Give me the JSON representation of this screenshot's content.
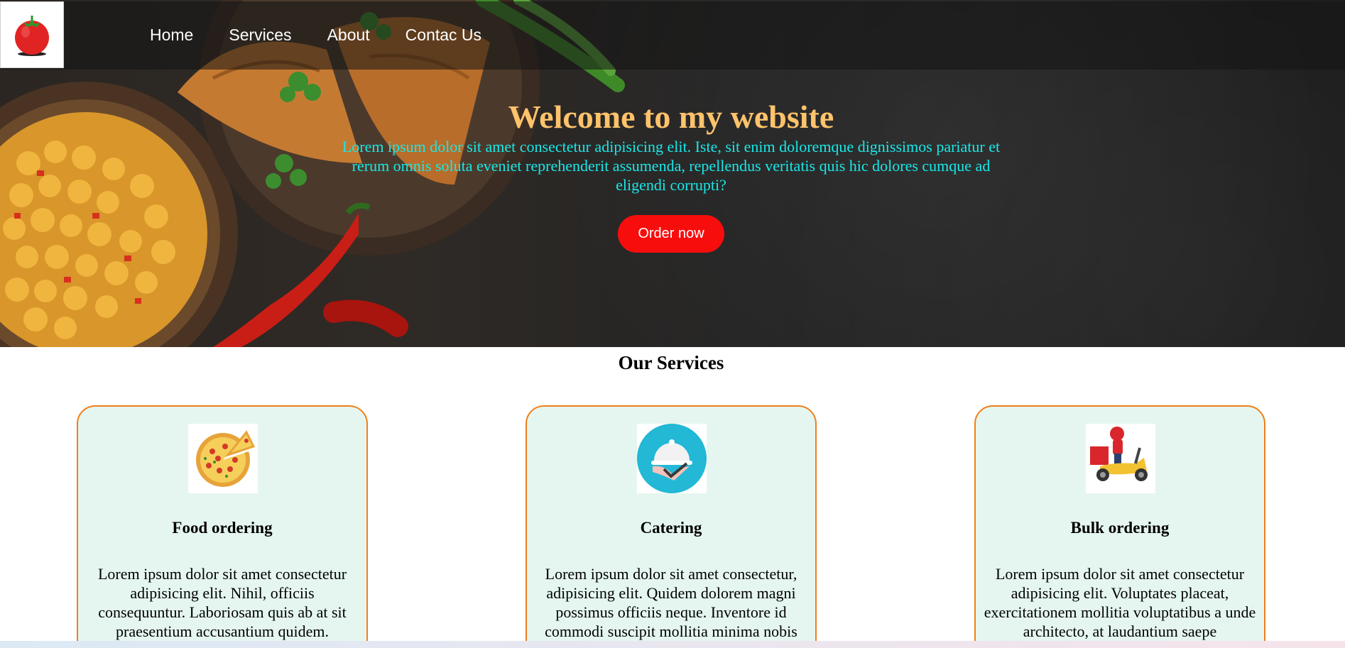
{
  "nav": {
    "logo_icon": "tomato-icon",
    "links": [
      "Home",
      "Services",
      "About",
      "Contac Us"
    ]
  },
  "hero": {
    "title": "Welcome to my website",
    "text": "Lorem ipsum dolor sit amet consectetur adipisicing elit. Iste, sit enim doloremque dignissimos pariatur et rerum omnis soluta eveniet reprehenderit assumenda, repellendus veritatis quis hic dolores cumque ad eligendi corrupti?",
    "button": "Order now",
    "title_color": "#ffc36b",
    "text_color": "#19e8e8",
    "button_color": "#f80d0d"
  },
  "services": {
    "heading": "Our Services",
    "card_bg": "#e5f6f0",
    "card_border": "#f07f1a",
    "cards": [
      {
        "icon": "pizza-icon",
        "title": "Food ordering",
        "text": "Lorem ipsum dolor sit amet consectetur adipisicing elit. Nihil, officiis consequuntur. Laboriosam quis ab at sit praesentium accusantium quidem."
      },
      {
        "icon": "catering-cloche-icon",
        "title": "Catering",
        "text": "Lorem ipsum dolor sit amet consectetur, adipisicing elit. Quidem dolorem magni possimus officiis neque. Inventore id commodi suscipit mollitia minima nobis"
      },
      {
        "icon": "delivery-scooter-icon",
        "title": "Bulk ordering",
        "text": "Lorem ipsum dolor sit amet consectetur adipisicing elit. Voluptates placeat, exercitationem mollitia voluptatibus a unde architecto, at laudantium saepe"
      }
    ]
  }
}
